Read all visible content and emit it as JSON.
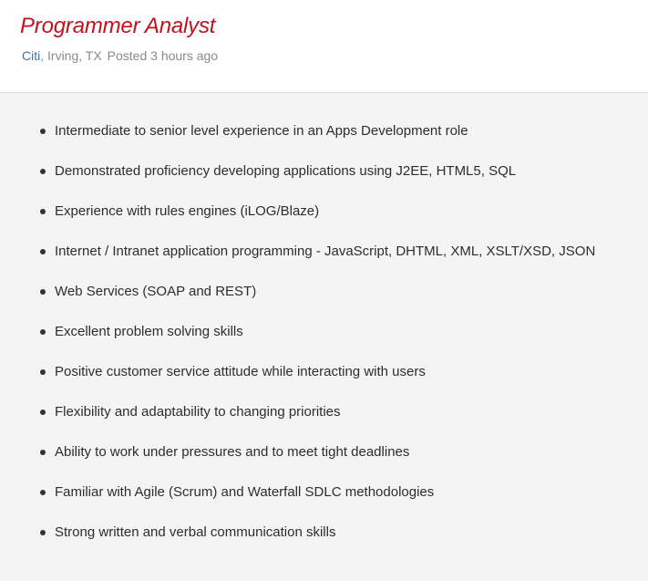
{
  "job": {
    "title": "Programmer Analyst",
    "company": "Citi",
    "location": ", Irving, TX",
    "posted": "Posted 3 hours ago"
  },
  "requirements": [
    "Intermediate to senior level experience in an Apps Development role",
    "Demonstrated proficiency developing applications using J2EE, HTML5, SQL",
    "Experience with rules engines (iLOG/Blaze)",
    "Internet / Intranet application programming - JavaScript, DHTML, XML, XSLT/XSD, JSON",
    "Web Services (SOAP and REST)",
    "Excellent problem solving skills",
    "Positive customer service attitude while interacting with users",
    "Flexibility and adaptability to changing priorities",
    "Ability to work under pressures and to meet tight deadlines",
    "Familiar with Agile (Scrum) and Waterfall SDLC methodologies",
    "Strong written and verbal communication skills"
  ],
  "colors": {
    "title": "#c0121f",
    "company_link": "#3f74a3",
    "meta": "#8a8a8a",
    "page_background": "#f4f4f4"
  }
}
